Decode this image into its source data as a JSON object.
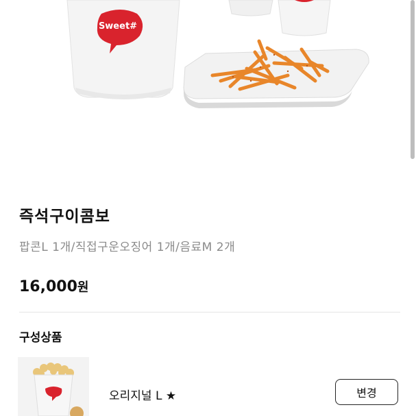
{
  "product": {
    "title": "즉석구이콤보",
    "description": "팝콘L 1개/직접구운오징어 1개/음료M 2개",
    "price_amount": "16,000",
    "price_unit": "원"
  },
  "hero": {
    "cup_logo_text": "Sweet#"
  },
  "components": {
    "section_title": "구성상품",
    "items": [
      {
        "name": "오리지널 L ★",
        "button_label": "변경",
        "thumb_logo": "Sweet#"
      }
    ]
  },
  "colors": {
    "brand_red": "#d9232d",
    "fries_orange": "#e8862a",
    "muted_text": "#8a8a8a"
  }
}
